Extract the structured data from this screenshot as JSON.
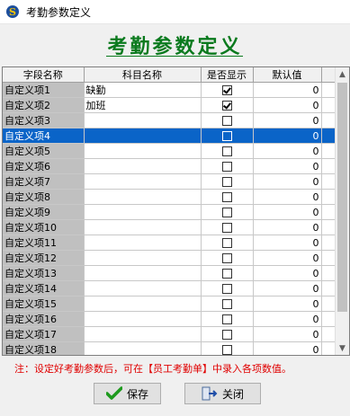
{
  "window": {
    "title": "考勤参数定义"
  },
  "header": {
    "title": "考勤参数定义"
  },
  "grid": {
    "columns": [
      "字段名称",
      "科目名称",
      "是否显示",
      "默认值"
    ],
    "rows": [
      {
        "field": "自定义项1",
        "subject": "缺勤",
        "show": true,
        "default": "0"
      },
      {
        "field": "自定义项2",
        "subject": "加班",
        "show": true,
        "default": "0"
      },
      {
        "field": "自定义项3",
        "subject": "",
        "show": false,
        "default": "0"
      },
      {
        "field": "自定义项4",
        "subject": "",
        "show": false,
        "default": "0",
        "selected": true
      },
      {
        "field": "自定义项5",
        "subject": "",
        "show": false,
        "default": "0"
      },
      {
        "field": "自定义项6",
        "subject": "",
        "show": false,
        "default": "0"
      },
      {
        "field": "自定义项7",
        "subject": "",
        "show": false,
        "default": "0"
      },
      {
        "field": "自定义项8",
        "subject": "",
        "show": false,
        "default": "0"
      },
      {
        "field": "自定义项9",
        "subject": "",
        "show": false,
        "default": "0"
      },
      {
        "field": "自定义项10",
        "subject": "",
        "show": false,
        "default": "0"
      },
      {
        "field": "自定义项11",
        "subject": "",
        "show": false,
        "default": "0"
      },
      {
        "field": "自定义项12",
        "subject": "",
        "show": false,
        "default": "0"
      },
      {
        "field": "自定义项13",
        "subject": "",
        "show": false,
        "default": "0"
      },
      {
        "field": "自定义项14",
        "subject": "",
        "show": false,
        "default": "0"
      },
      {
        "field": "自定义项15",
        "subject": "",
        "show": false,
        "default": "0"
      },
      {
        "field": "自定义项16",
        "subject": "",
        "show": false,
        "default": "0"
      },
      {
        "field": "自定义项17",
        "subject": "",
        "show": false,
        "default": "0"
      },
      {
        "field": "自定义项18",
        "subject": "",
        "show": false,
        "default": "0"
      }
    ]
  },
  "note": "注：设定好考勤参数后，可在【员工考勤单】中录入各项数值。",
  "buttons": {
    "save": "保存",
    "close": "关闭"
  },
  "icons": {
    "app": "app-s-icon",
    "save": "check-icon",
    "close": "exit-door-icon"
  },
  "colors": {
    "title_green": "#0b7a1e",
    "note_red": "#e00000",
    "selection_blue": "#0a64c8"
  }
}
